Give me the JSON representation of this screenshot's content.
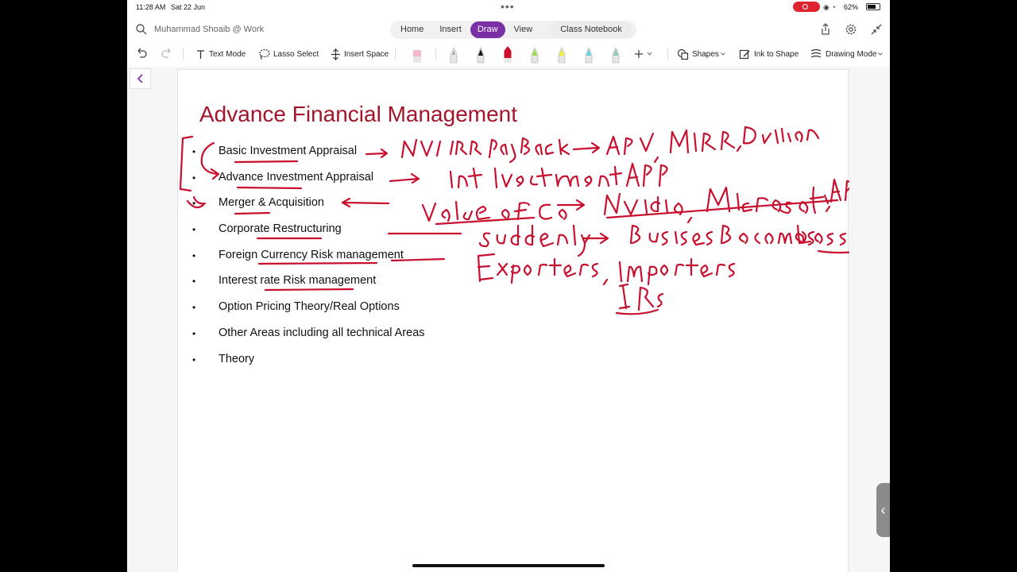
{
  "status_bar": {
    "time": "11:28 AM",
    "date": "Sat 22 Jun",
    "battery": "62%"
  },
  "nav": {
    "notebook_title": "Muhammad Shoaib @ Work",
    "tabs": [
      {
        "label": "Home"
      },
      {
        "label": "Insert"
      },
      {
        "label": "Draw",
        "active": true
      },
      {
        "label": "View"
      }
    ],
    "class_notebook": "Class Notebook"
  },
  "toolbar": {
    "text_mode": "Text Mode",
    "lasso_select": "Lasso Select",
    "insert_space": "Insert Space",
    "shapes": "Shapes",
    "ink_to_shape": "Ink to Shape",
    "drawing_mode": "Drawing Mode",
    "pens": [
      {
        "name": "eraser",
        "color": "#f2b8c6"
      },
      {
        "name": "pencil-grey",
        "color": "#9a9a9a"
      },
      {
        "name": "pen-black",
        "color": "#111111"
      },
      {
        "name": "pen-red",
        "color": "#c8102e"
      },
      {
        "name": "highlighter-green",
        "color": "#8fe23c"
      },
      {
        "name": "highlighter-yellow",
        "color": "#f4f11a"
      },
      {
        "name": "pen-cyan",
        "color": "#5ad1e6"
      },
      {
        "name": "pen-teal",
        "color": "#7fc9bd"
      }
    ]
  },
  "page": {
    "title": "Advance Financial Management",
    "bullets": [
      "Basic Investment Appraisal",
      "Advance Investment Appraisal",
      "Merger & Acquisition",
      "Corporate Restructuring",
      "Foreign Currency Risk management",
      "Interest rate Risk management",
      "Option Pricing Theory/Real Options",
      "Other Areas including all technical Areas",
      "Theory"
    ]
  },
  "colors": {
    "accent": "#7b2fa4",
    "title": "#a3152a",
    "ink": "#c8102e"
  }
}
